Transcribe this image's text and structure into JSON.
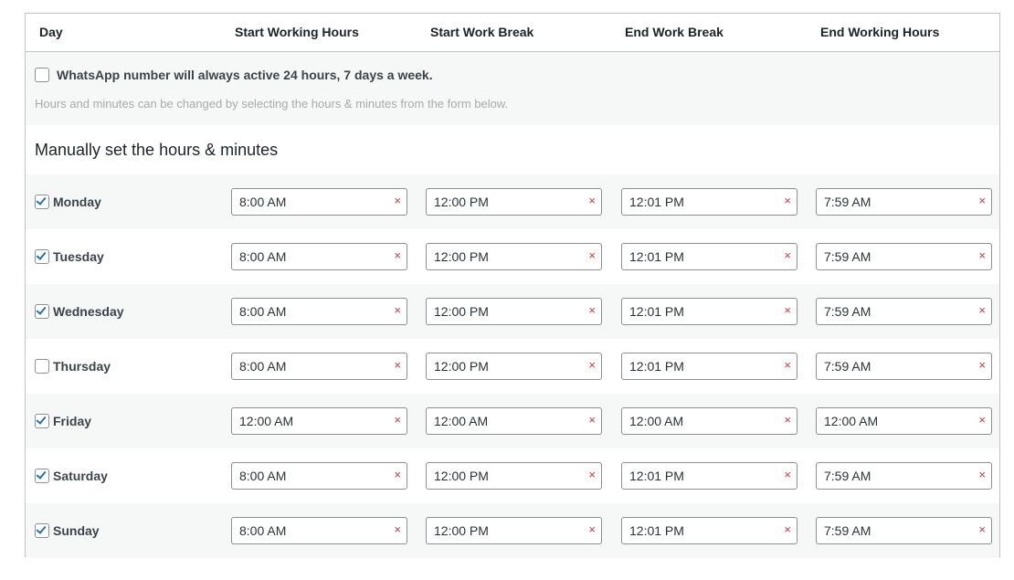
{
  "header": {
    "day": "Day",
    "start_working": "Start Working Hours",
    "start_break": "Start Work Break",
    "end_break": "End Work Break",
    "end_working": "End Working Hours"
  },
  "always_active": {
    "label": "WhatsApp number will always active 24 hours, 7 days a week.",
    "checked": false,
    "hint": "Hours and minutes can be changed by selecting the hours & minutes from the form below."
  },
  "manual_title": "Manually set the hours & minutes",
  "clear_symbol": "×",
  "days": [
    {
      "name": "Monday",
      "checked": true,
      "start": "8:00 AM",
      "break_start": "12:00 PM",
      "break_end": "12:01 PM",
      "end": "7:59 AM"
    },
    {
      "name": "Tuesday",
      "checked": true,
      "start": "8:00 AM",
      "break_start": "12:00 PM",
      "break_end": "12:01 PM",
      "end": "7:59 AM"
    },
    {
      "name": "Wednesday",
      "checked": true,
      "start": "8:00 AM",
      "break_start": "12:00 PM",
      "break_end": "12:01 PM",
      "end": "7:59 AM"
    },
    {
      "name": "Thursday",
      "checked": false,
      "start": "8:00 AM",
      "break_start": "12:00 PM",
      "break_end": "12:01 PM",
      "end": "7:59 AM"
    },
    {
      "name": "Friday",
      "checked": true,
      "start": "12:00 AM",
      "break_start": "12:00 AM",
      "break_end": "12:00 AM",
      "end": "12:00 AM"
    },
    {
      "name": "Saturday",
      "checked": true,
      "start": "8:00 AM",
      "break_start": "12:00 PM",
      "break_end": "12:01 PM",
      "end": "7:59 AM"
    },
    {
      "name": "Sunday",
      "checked": true,
      "start": "8:00 AM",
      "break_start": "12:00 PM",
      "break_end": "12:01 PM",
      "end": "7:59 AM"
    }
  ],
  "colors": {
    "checkbox_check": "#2271b1",
    "clear_icon": "#d63638",
    "row_alt_bg": "#f6f7f7",
    "border": "#c3c4c7"
  }
}
